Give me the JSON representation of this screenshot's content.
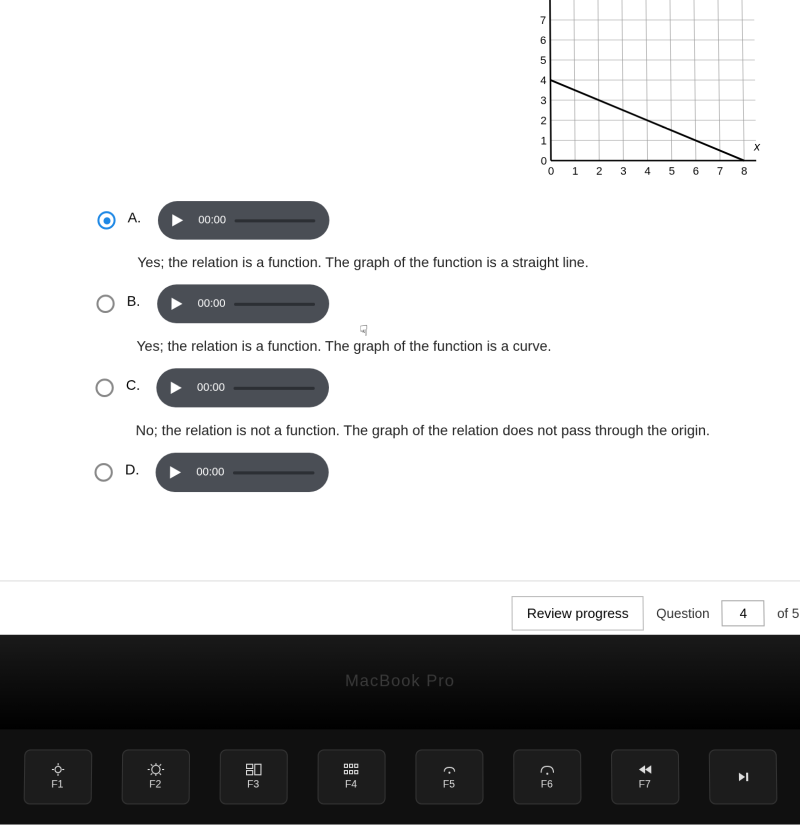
{
  "chart_data": {
    "type": "line",
    "x": [
      0,
      8
    ],
    "y": [
      4,
      0
    ],
    "xlabel": "x",
    "ylabel": "",
    "xlim": [
      0,
      8
    ],
    "ylim_visible": [
      0,
      7
    ],
    "xticks": [
      0,
      1,
      2,
      3,
      4,
      5,
      6,
      7,
      8
    ],
    "yticks": [
      0,
      1,
      2,
      3,
      4,
      5,
      6,
      7
    ]
  },
  "choices": [
    {
      "letter": "A.",
      "selected": true,
      "time": "00:00",
      "text": "Yes; the relation is a function. The graph of the function is a straight line."
    },
    {
      "letter": "B.",
      "selected": false,
      "time": "00:00",
      "text": "Yes; the relation is a function. The graph of the function is a curve."
    },
    {
      "letter": "C.",
      "selected": false,
      "time": "00:00",
      "text": "No; the relation is not a function. The graph of the relation does not pass through the origin."
    },
    {
      "letter": "D.",
      "selected": false,
      "time": "00:00",
      "text": ""
    }
  ],
  "footer": {
    "review": "Review progress",
    "question_label": "Question",
    "question_number": "4",
    "of": "of 5"
  },
  "laptop": {
    "brand": "MacBook Pro",
    "keys": [
      "F1",
      "F2",
      "F3",
      "F4",
      "F5",
      "F6",
      "F7"
    ]
  }
}
